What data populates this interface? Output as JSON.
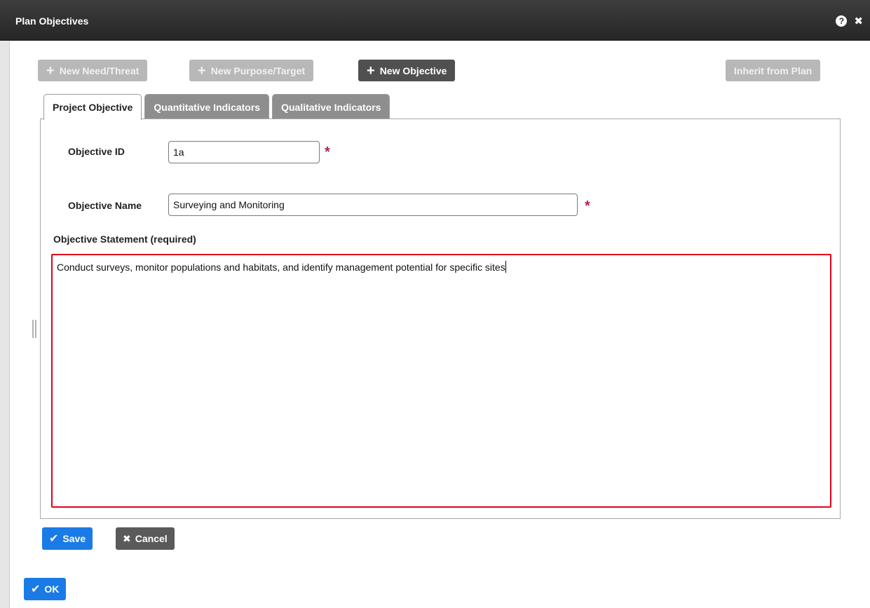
{
  "window": {
    "title": "Plan Objectives",
    "help_icon": "?",
    "close_icon": "✖"
  },
  "toolbar": {
    "new_need": "New Need/Threat",
    "new_purpose": "New Purpose/Target",
    "new_objective": "New Objective",
    "inherit": "Inherit from Plan",
    "plus": "+"
  },
  "tabs": [
    {
      "label": "Project Objective",
      "active": true
    },
    {
      "label": "Quantitative Indicators",
      "active": false
    },
    {
      "label": "Qualitative Indicators",
      "active": false
    }
  ],
  "form": {
    "objective_id_label": "Objective ID",
    "objective_id_value": "1a",
    "objective_name_label": "Objective Name",
    "objective_name_value": "Surveying and Monitoring",
    "statement_label": "Objective Statement (required)",
    "statement_value": "Conduct surveys, monitor populations and habitats, and identify management potential for specific sites",
    "required_mark": "*"
  },
  "actions": {
    "save": "Save",
    "cancel": "Cancel",
    "ok": "OK",
    "check": "✔",
    "x": "✖"
  },
  "colors": {
    "accent": "#1a7be6",
    "required": "#b32445",
    "error_border": "#e3001b"
  }
}
